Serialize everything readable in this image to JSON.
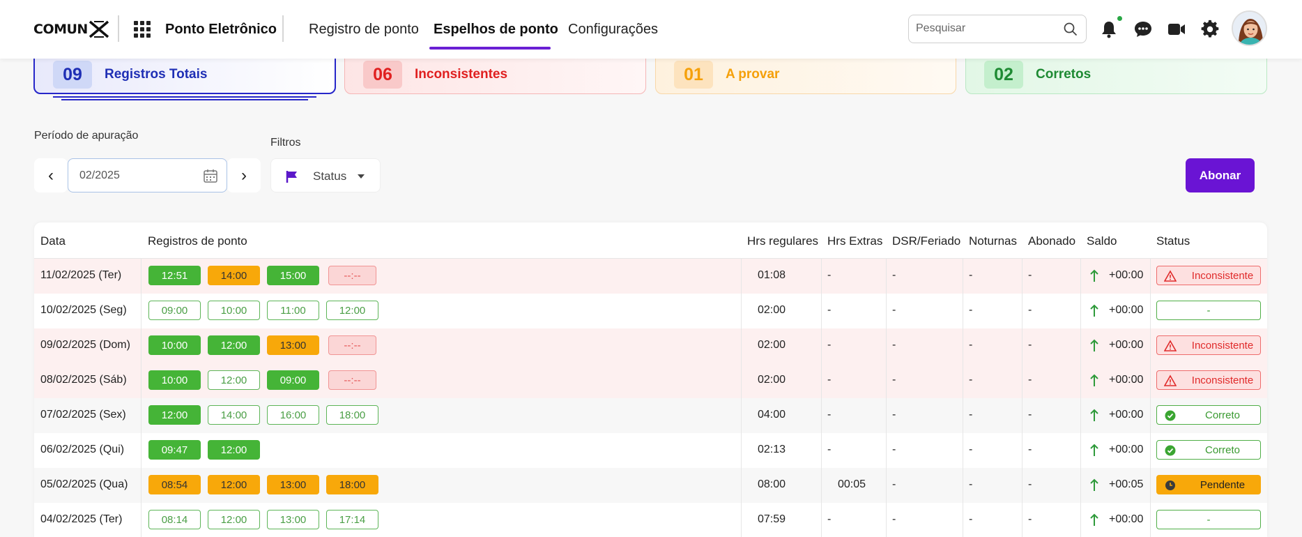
{
  "header": {
    "logo_text": "COMUN",
    "app_name": "Ponto Eletrônico",
    "tabs": [
      {
        "label": "Registro de ponto",
        "active": false
      },
      {
        "label": "Espelhos de ponto",
        "active": true
      },
      {
        "label": "Configurações",
        "active": false
      }
    ],
    "search_placeholder": "Pesquisar",
    "icons": [
      "bell-icon",
      "chat-icon",
      "video-icon",
      "gear-icon"
    ],
    "notification_status_color": "#29a745"
  },
  "summary": {
    "total": {
      "count": "09",
      "label": "Registros Totais"
    },
    "inconsistentes": {
      "count": "06",
      "label": "Inconsistentes"
    },
    "a_provar": {
      "count": "01",
      "label": "A provar"
    },
    "corretos": {
      "count": "02",
      "label": "Corretos"
    }
  },
  "filters": {
    "period_label": "Período de apuração",
    "period_value": "02/2025",
    "prev_label": "‹",
    "next_label": "›",
    "filters_label": "Filtros",
    "status_label": "Status",
    "abonar_label": "Abonar"
  },
  "table": {
    "columns": [
      "Data",
      "Registros de ponto",
      "Hrs regulares",
      "Hrs Extras",
      "DSR/Feriado",
      "Noturnas",
      "Abonado",
      "Saldo",
      "Status"
    ],
    "rows": [
      {
        "date": "11/02/2025 (Ter)",
        "bg": "red",
        "punches": [
          {
            "t": "12:51",
            "s": "gfill"
          },
          {
            "t": "14:00",
            "s": "ofill"
          },
          {
            "t": "15:00",
            "s": "gfill"
          },
          {
            "t": "--:--",
            "s": "rdash"
          }
        ],
        "regular": "01:08",
        "extras": "-",
        "dsr": "-",
        "noturnas": "-",
        "abonado": "-",
        "saldo": "+00:00",
        "status": "Inconsistente",
        "status_type": "inc"
      },
      {
        "date": "10/02/2025 (Seg)",
        "bg": "white",
        "punches": [
          {
            "t": "09:00",
            "s": "gout"
          },
          {
            "t": "10:00",
            "s": "gout"
          },
          {
            "t": "11:00",
            "s": "gout"
          },
          {
            "t": "12:00",
            "s": "gout"
          }
        ],
        "regular": "02:00",
        "extras": "-",
        "dsr": "-",
        "noturnas": "-",
        "abonado": "-",
        "saldo": "+00:00",
        "status": "-",
        "status_type": "empty"
      },
      {
        "date": "09/02/2025 (Dom)",
        "bg": "red",
        "punches": [
          {
            "t": "10:00",
            "s": "gfill"
          },
          {
            "t": "12:00",
            "s": "gfill"
          },
          {
            "t": "13:00",
            "s": "ofill"
          },
          {
            "t": "--:--",
            "s": "rdash"
          }
        ],
        "regular": "02:00",
        "extras": "-",
        "dsr": "-",
        "noturnas": "-",
        "abonado": "-",
        "saldo": "+00:00",
        "status": "Inconsistente",
        "status_type": "inc"
      },
      {
        "date": "08/02/2025 (Sáb)",
        "bg": "red",
        "punches": [
          {
            "t": "10:00",
            "s": "gfill"
          },
          {
            "t": "12:00",
            "s": "gout"
          },
          {
            "t": "09:00",
            "s": "gfill"
          },
          {
            "t": "--:--",
            "s": "rdash"
          }
        ],
        "regular": "02:00",
        "extras": "-",
        "dsr": "-",
        "noturnas": "-",
        "abonado": "-",
        "saldo": "+00:00",
        "status": "Inconsistente",
        "status_type": "inc"
      },
      {
        "date": "07/02/2025 (Sex)",
        "bg": "grey",
        "punches": [
          {
            "t": "12:00",
            "s": "gfill"
          },
          {
            "t": "14:00",
            "s": "gout"
          },
          {
            "t": "16:00",
            "s": "gout"
          },
          {
            "t": "18:00",
            "s": "gout"
          }
        ],
        "regular": "04:00",
        "extras": "-",
        "dsr": "-",
        "noturnas": "-",
        "abonado": "-",
        "saldo": "+00:00",
        "status": "Correto",
        "status_type": "cor"
      },
      {
        "date": "06/02/2025 (Qui)",
        "bg": "white",
        "punches": [
          {
            "t": "09:47",
            "s": "gfill"
          },
          {
            "t": "12:00",
            "s": "gfill"
          }
        ],
        "regular": "02:13",
        "extras": "-",
        "dsr": "-",
        "noturnas": "-",
        "abonado": "-",
        "saldo": "+00:00",
        "status": "Correto",
        "status_type": "cor"
      },
      {
        "date": "05/02/2025 (Qua)",
        "bg": "grey",
        "punches": [
          {
            "t": "08:54",
            "s": "ofill"
          },
          {
            "t": "12:00",
            "s": "ofill"
          },
          {
            "t": "13:00",
            "s": "ofill"
          },
          {
            "t": "18:00",
            "s": "ofill"
          }
        ],
        "regular": "08:00",
        "extras": "00:05",
        "dsr": "-",
        "noturnas": "-",
        "abonado": "-",
        "saldo": "+00:05",
        "status": "Pendente",
        "status_type": "pen"
      },
      {
        "date": "04/02/2025 (Ter)",
        "bg": "white",
        "punches": [
          {
            "t": "08:14",
            "s": "gout"
          },
          {
            "t": "12:00",
            "s": "gout"
          },
          {
            "t": "13:00",
            "s": "gout"
          },
          {
            "t": "17:14",
            "s": "gout"
          }
        ],
        "regular": "07:59",
        "extras": "-",
        "dsr": "-",
        "noturnas": "-",
        "abonado": "-",
        "saldo": "+00:00",
        "status": "-",
        "status_type": "empty"
      }
    ]
  }
}
